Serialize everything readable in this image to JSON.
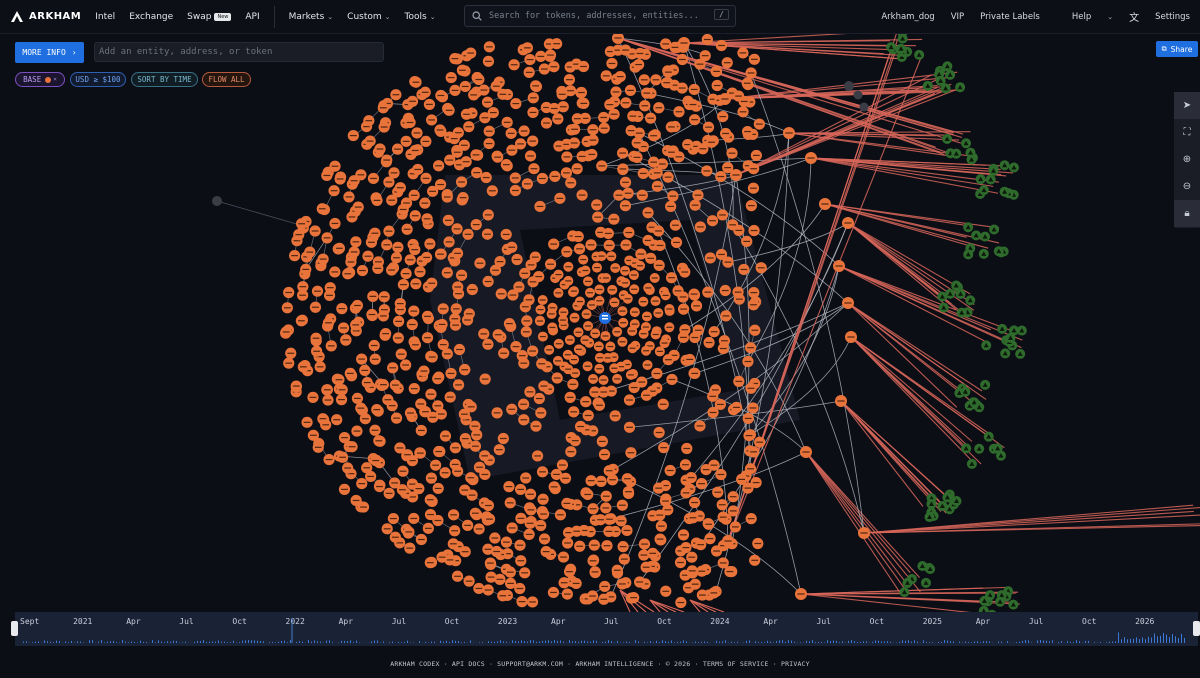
{
  "nav": {
    "logo": "ARKHAM",
    "items": [
      "Intel",
      "Exchange"
    ],
    "swap": "Swap",
    "swap_badge": "New",
    "api": "API",
    "menus": [
      "Markets",
      "Custom",
      "Tools"
    ],
    "search_placeholder": "Search for tokens, addresses, entities...",
    "search_shortcut": "/",
    "right": [
      "Arkham_dog",
      "VIP",
      "Private Labels"
    ],
    "help": "Help",
    "settings": "Settings"
  },
  "controls": {
    "more_info": "MORE INFO",
    "entity_placeholder": "Add an entity, address, or token",
    "chips": [
      "BASE",
      "USD ≥ $100",
      "SORT BY TIME",
      "FLOW ALL"
    ],
    "share": "Share"
  },
  "timeline": {
    "labels": [
      "Sept",
      "2021",
      "Apr",
      "Jul",
      "Oct",
      "2022",
      "Apr",
      "Jul",
      "Oct",
      "2023",
      "Apr",
      "Jul",
      "Oct",
      "2024",
      "Apr",
      "Jul",
      "Oct",
      "2025",
      "Apr",
      "Jul",
      "Oct",
      "2026"
    ]
  },
  "footer": "ARKHAM CODEX · API DOCS · SUPPORT@ARKM.COM · ARKHAM INTELLIGENCE · © 2026 · TERMS OF SERVICE · PRIVACY",
  "colors": {
    "node": "#e8743b",
    "link": "#b9bdc6",
    "outflow": "#d9675a",
    "leaf": "#2f6b2c",
    "accent": "#1f6fe0"
  }
}
